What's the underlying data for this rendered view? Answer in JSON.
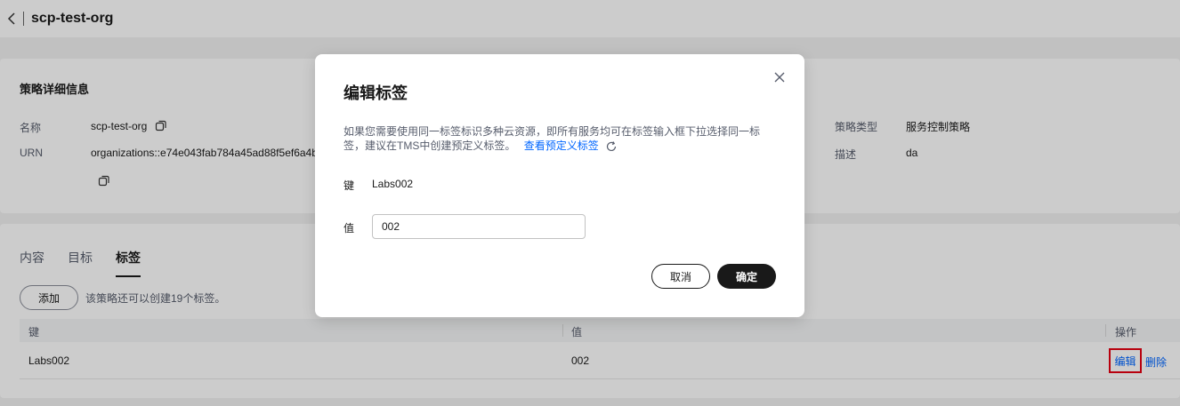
{
  "header": {
    "title": "scp-test-org"
  },
  "detail": {
    "section_title": "策略详细信息",
    "name_label": "名称",
    "name_value": "scp-test-org",
    "urn_label": "URN",
    "urn_value": "organizations::e74e043fab784a45ad88f5ef6a4b",
    "type_label": "策略类型",
    "type_value": "服务控制策略",
    "desc_label": "描述",
    "desc_value": "da"
  },
  "tabs": [
    {
      "label": "内容"
    },
    {
      "label": "目标"
    },
    {
      "label": "标签",
      "active": true
    }
  ],
  "tags": {
    "add_label": "添加",
    "hint": "该策略还可以创建19个标签。",
    "columns": {
      "key": "键",
      "value": "值",
      "actions": "操作"
    },
    "rows": [
      {
        "key": "Labs002",
        "value": "002",
        "edit": "编辑",
        "delete": "删除"
      }
    ]
  },
  "dialog": {
    "title": "编辑标签",
    "desc": "如果您需要使用同一标签标识多种云资源，即所有服务均可在标签输入框下拉选择同一标签，建议在TMS中创建预定义标签。",
    "desc_link": "查看预定义标签",
    "key_label": "键",
    "key_value": "Labs002",
    "value_label": "值",
    "value_input": "002",
    "cancel_label": "取消",
    "ok_label": "确定"
  },
  "colors": {
    "link": "#0066ff",
    "primary_button": "#191919",
    "highlight_border": "#e60012"
  }
}
